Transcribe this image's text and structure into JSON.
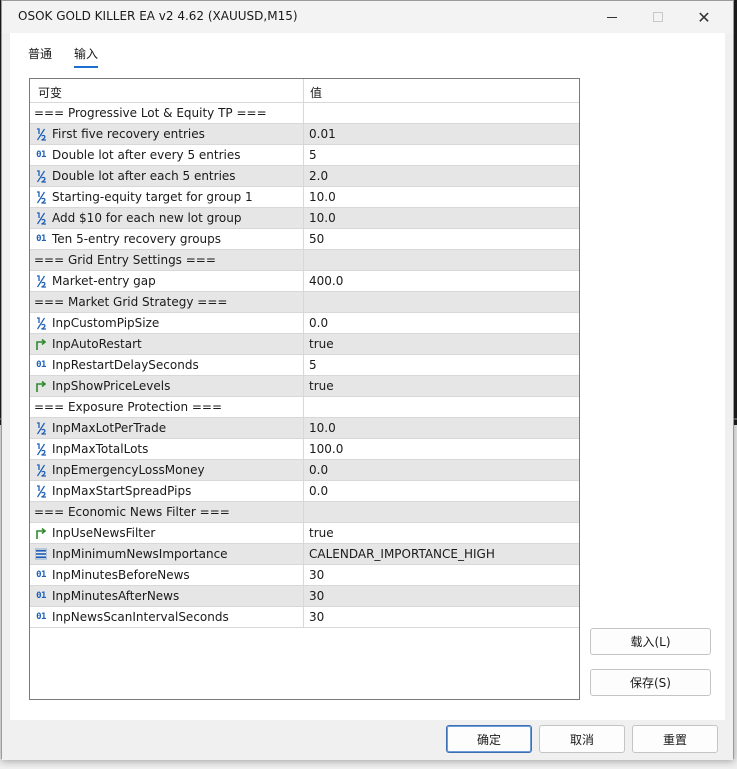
{
  "window": {
    "title": "OSOK GOLD KILLER EA v2 4.62 (XAUUSD,M15)"
  },
  "tabs": [
    {
      "label": "普通",
      "active": false
    },
    {
      "label": "输入",
      "active": true
    }
  ],
  "grid": {
    "header": {
      "variable": "可变",
      "value": "值"
    },
    "rows": [
      {
        "icon": "none",
        "name": "=== Progressive Lot & Equity TP ===",
        "value": "",
        "section": true
      },
      {
        "icon": "half",
        "name": "First five recovery entries",
        "value": "0.01"
      },
      {
        "icon": "int",
        "name": "Double lot after every 5 entries",
        "value": "5"
      },
      {
        "icon": "half",
        "name": "Double lot after each 5 entries",
        "value": "2.0"
      },
      {
        "icon": "half",
        "name": "Starting-equity target for group 1",
        "value": "10.0"
      },
      {
        "icon": "half",
        "name": "Add $10 for each new lot group",
        "value": "10.0"
      },
      {
        "icon": "int",
        "name": "Ten 5-entry recovery groups",
        "value": "50"
      },
      {
        "icon": "none",
        "name": "=== Grid Entry Settings ===",
        "value": "",
        "section": true
      },
      {
        "icon": "half",
        "name": "Market-entry gap",
        "value": "400.0"
      },
      {
        "icon": "none",
        "name": "=== Market Grid Strategy ===",
        "value": "",
        "section": true
      },
      {
        "icon": "half",
        "name": "InpCustomPipSize",
        "value": "0.0"
      },
      {
        "icon": "bool",
        "name": "InpAutoRestart",
        "value": "true"
      },
      {
        "icon": "int",
        "name": "InpRestartDelaySeconds",
        "value": "5"
      },
      {
        "icon": "bool",
        "name": "InpShowPriceLevels",
        "value": "true"
      },
      {
        "icon": "none",
        "name": "=== Exposure Protection ===",
        "value": "",
        "section": true
      },
      {
        "icon": "half",
        "name": "InpMaxLotPerTrade",
        "value": "10.0"
      },
      {
        "icon": "half",
        "name": "InpMaxTotalLots",
        "value": "100.0"
      },
      {
        "icon": "half",
        "name": "InpEmergencyLossMoney",
        "value": "0.0"
      },
      {
        "icon": "half",
        "name": "InpMaxStartSpreadPips",
        "value": "0.0"
      },
      {
        "icon": "none",
        "name": "=== Economic News Filter ===",
        "value": "",
        "section": true
      },
      {
        "icon": "bool",
        "name": "InpUseNewsFilter",
        "value": "true"
      },
      {
        "icon": "enum",
        "name": "InpMinimumNewsImportance",
        "value": "CALENDAR_IMPORTANCE_HIGH"
      },
      {
        "icon": "int",
        "name": "InpMinutesBeforeNews",
        "value": "30"
      },
      {
        "icon": "int",
        "name": "InpMinutesAfterNews",
        "value": "30"
      },
      {
        "icon": "int",
        "name": "InpNewsScanIntervalSeconds",
        "value": "30"
      }
    ]
  },
  "side_buttons": {
    "load": "载入(L)",
    "save": "保存(S)"
  },
  "footer_buttons": {
    "ok": "确定",
    "cancel": "取消",
    "reset": "重置"
  },
  "icon_glyphs": {
    "int": "01"
  },
  "colors": {
    "accent": "#1a6fd1",
    "half_icon": "#1d5fb8",
    "bool_icon": "#2e8b2e",
    "row_alt": "#e6e6e6"
  }
}
